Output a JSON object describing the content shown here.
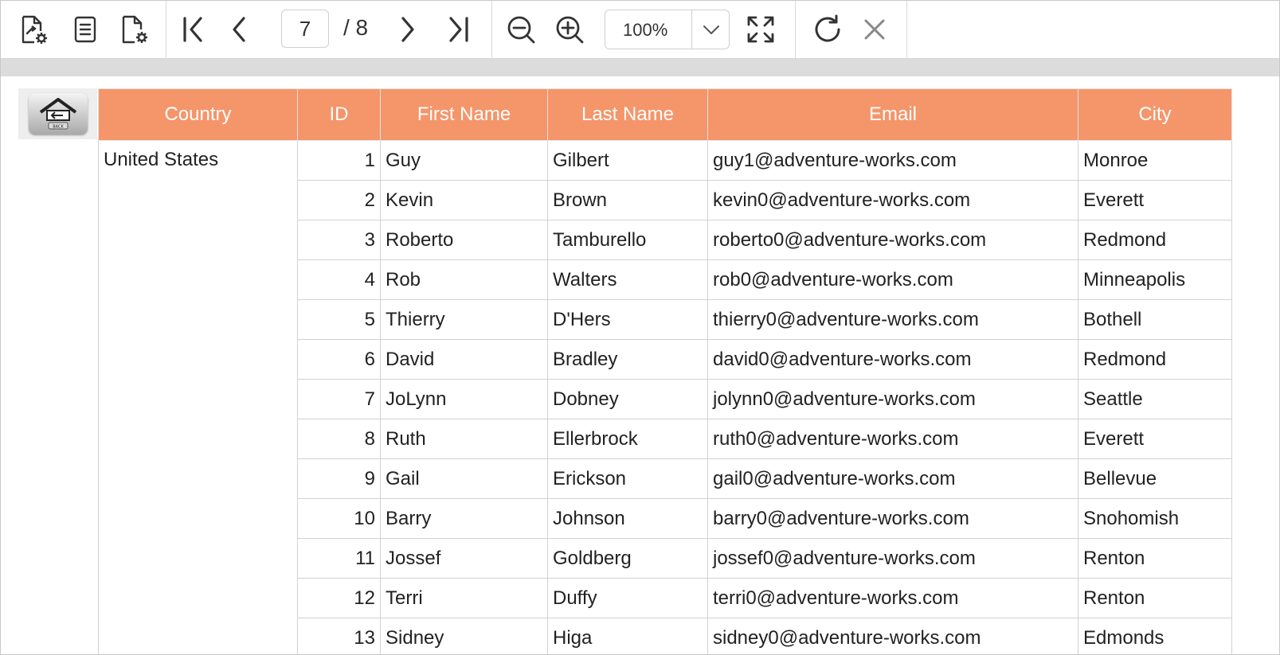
{
  "toolbar": {
    "current_page": "7",
    "total_pages": "/ 8",
    "zoom_value": "100%"
  },
  "back_button_caption": "BACK",
  "report": {
    "columns": [
      "Country",
      "ID",
      "First Name",
      "Last Name",
      "Email",
      "City"
    ],
    "country": "United States",
    "rows": [
      {
        "id": "1",
        "first": "Guy",
        "last": "Gilbert",
        "email": "guy1@adventure-works.com",
        "city": "Monroe"
      },
      {
        "id": "2",
        "first": "Kevin",
        "last": "Brown",
        "email": "kevin0@adventure-works.com",
        "city": "Everett"
      },
      {
        "id": "3",
        "first": "Roberto",
        "last": "Tamburello",
        "email": "roberto0@adventure-works.com",
        "city": "Redmond"
      },
      {
        "id": "4",
        "first": "Rob",
        "last": "Walters",
        "email": "rob0@adventure-works.com",
        "city": "Minneapolis"
      },
      {
        "id": "5",
        "first": "Thierry",
        "last": "D'Hers",
        "email": "thierry0@adventure-works.com",
        "city": "Bothell"
      },
      {
        "id": "6",
        "first": "David",
        "last": "Bradley",
        "email": "david0@adventure-works.com",
        "city": "Redmond"
      },
      {
        "id": "7",
        "first": "JoLynn",
        "last": "Dobney",
        "email": "jolynn0@adventure-works.com",
        "city": "Seattle"
      },
      {
        "id": "8",
        "first": "Ruth",
        "last": "Ellerbrock",
        "email": "ruth0@adventure-works.com",
        "city": "Everett"
      },
      {
        "id": "9",
        "first": "Gail",
        "last": "Erickson",
        "email": "gail0@adventure-works.com",
        "city": "Bellevue"
      },
      {
        "id": "10",
        "first": "Barry",
        "last": "Johnson",
        "email": "barry0@adventure-works.com",
        "city": "Snohomish"
      },
      {
        "id": "11",
        "first": "Jossef",
        "last": "Goldberg",
        "email": "jossef0@adventure-works.com",
        "city": "Renton"
      },
      {
        "id": "12",
        "first": "Terri",
        "last": "Duffy",
        "email": "terri0@adventure-works.com",
        "city": "Renton"
      },
      {
        "id": "13",
        "first": "Sidney",
        "last": "Higa",
        "email": "sidney0@adventure-works.com",
        "city": "Edmonds"
      }
    ]
  }
}
